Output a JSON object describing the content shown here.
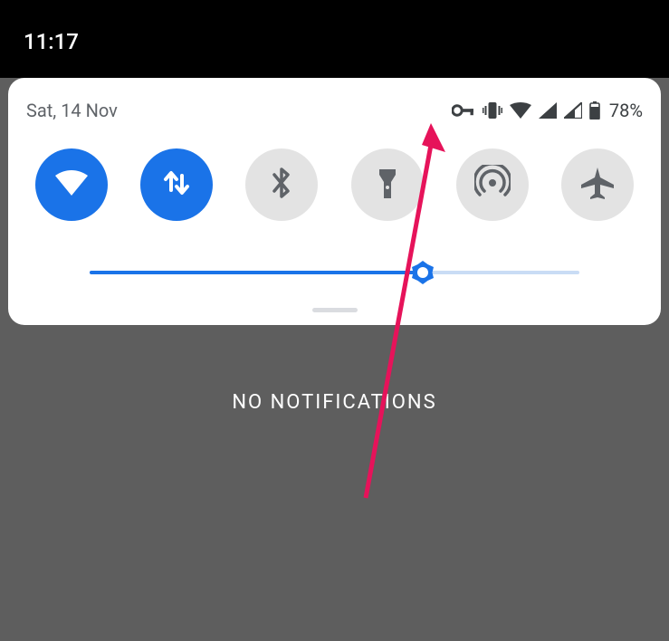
{
  "clock": "11:17",
  "date": "Sat, 14 Nov",
  "battery_percent": "78%",
  "no_notifications_text": "NO NOTIFICATIONS",
  "brightness": {
    "value": 68,
    "max": 100
  },
  "status_icons": [
    "vpn-key",
    "vibrate",
    "wifi",
    "signal-1",
    "signal-2",
    "battery"
  ],
  "tiles": [
    {
      "name": "wifi",
      "active": true
    },
    {
      "name": "data",
      "active": true
    },
    {
      "name": "bluetooth",
      "active": false
    },
    {
      "name": "flashlight",
      "active": false
    },
    {
      "name": "hotspot",
      "active": false
    },
    {
      "name": "airplane",
      "active": false
    }
  ],
  "annotation": {
    "arrow_color": "#e91e63"
  }
}
